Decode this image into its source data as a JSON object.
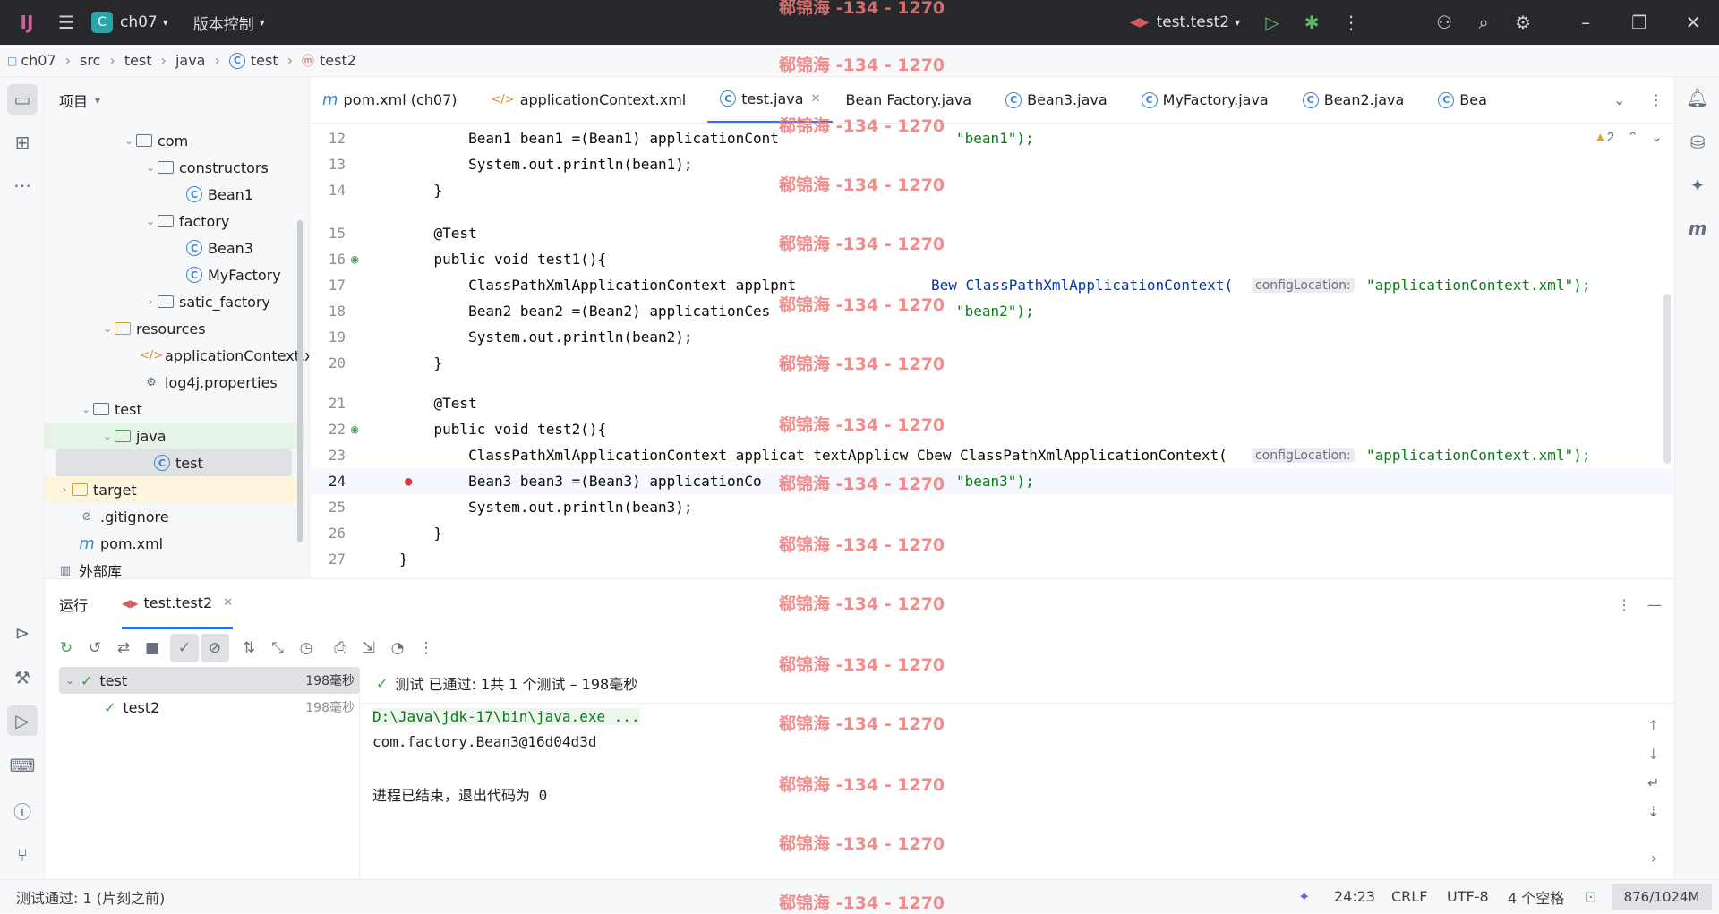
{
  "titlebar": {
    "project": "ch07",
    "project_badge": "C",
    "vcs": "版本控制",
    "run_config": "test.test2"
  },
  "breadcrumbs": [
    "ch07",
    "src",
    "test",
    "java",
    "test",
    "test2"
  ],
  "project_panel": {
    "title": "项目",
    "items": [
      {
        "label": "com",
        "type": "package"
      },
      {
        "label": "constructors",
        "type": "package"
      },
      {
        "label": "Bean1",
        "type": "class"
      },
      {
        "label": "factory",
        "type": "package"
      },
      {
        "label": "Bean3",
        "type": "class"
      },
      {
        "label": "MyFactory",
        "type": "class"
      },
      {
        "label": "satic_factory",
        "type": "package"
      },
      {
        "label": "resources",
        "type": "folder"
      },
      {
        "label": "applicationContext.x",
        "type": "xml"
      },
      {
        "label": "log4j.properties",
        "type": "properties"
      },
      {
        "label": "test",
        "type": "folder"
      },
      {
        "label": "java",
        "type": "folder"
      },
      {
        "label": "test",
        "type": "class"
      },
      {
        "label": "target",
        "type": "folder"
      },
      {
        "label": ".gitignore",
        "type": "ignore"
      },
      {
        "label": "pom.xml",
        "type": "maven"
      },
      {
        "label": "外部库",
        "type": "library"
      }
    ]
  },
  "tabs": [
    "pom.xml (ch07)",
    "applicationContext.xml",
    "test.java",
    "Bean Factory.java",
    "Bean3.java",
    "MyFactory.java",
    "Bean2.java",
    "Bea"
  ],
  "editor": {
    "warnings": "2",
    "lines": [
      {
        "n": "12",
        "text": "        Bean1 bean1 =(Bean1) applicationCont",
        "tail": "\"bean1\");"
      },
      {
        "n": "13",
        "text": "        System.out.println(bean1);"
      },
      {
        "n": "14",
        "text": "    }"
      },
      {
        "n": "15",
        "text": "    @Test"
      },
      {
        "n": "16",
        "text": "    public void test1(){"
      },
      {
        "n": "17",
        "text": "        ClassPathXmlApplicationContext applpnt",
        "hint": "configLocation:",
        "tail": "\"applicationContext.xml\");"
      },
      {
        "n": "18",
        "text": "        Bean2 bean2 =(Bean2) applicationCes",
        "tail": "\"bean2\");"
      },
      {
        "n": "19",
        "text": "        System.out.println(bean2);"
      },
      {
        "n": "20",
        "text": "    }"
      },
      {
        "n": "21",
        "text": "    @Test"
      },
      {
        "n": "22",
        "text": "    public void test2(){"
      },
      {
        "n": "23",
        "text": "        ClassPathXmlApplicationContext applicat textApplicw Cbew ClassPathXmlApplicationContext(",
        "hint": "configLocation:",
        "tail": "\"applicationContext.xml\");"
      },
      {
        "n": "24",
        "text": "        Bean3 bean3 =(Bean3) applicationCo",
        "tail": "\"bean3\");"
      },
      {
        "n": "25",
        "text": "        System.out.println(bean3);"
      },
      {
        "n": "26",
        "text": "    }"
      },
      {
        "n": "27",
        "text": "}"
      }
    ],
    "line17_mid": "Bew ClassPathXmlApplicationContext("
  },
  "run": {
    "tab_run": "运行",
    "tab_config": "test.test2",
    "summary": "测试 已通过: 1共 1 个测试 – 198毫秒",
    "tree": [
      {
        "label": "test",
        "time": "198毫秒"
      },
      {
        "label": "test2",
        "time": "198毫秒"
      }
    ],
    "console": [
      "D:\\Java\\jdk-17\\bin\\java.exe ...",
      "com.factory.Bean3@16d04d3d",
      "",
      "进程已结束，退出代码为 0"
    ]
  },
  "statusbar": {
    "left": "测试通过: 1 (片刻之前)",
    "pos": "24:23",
    "eol": "CRLF",
    "enc": "UTF-8",
    "indent": "4 个空格",
    "mem": "876/1024M"
  },
  "watermark": "郗锦海 -134 - 1270",
  "colors": {
    "accent": "#3574f0",
    "titlebar": "#27282c",
    "pass": "#3c9b43"
  }
}
